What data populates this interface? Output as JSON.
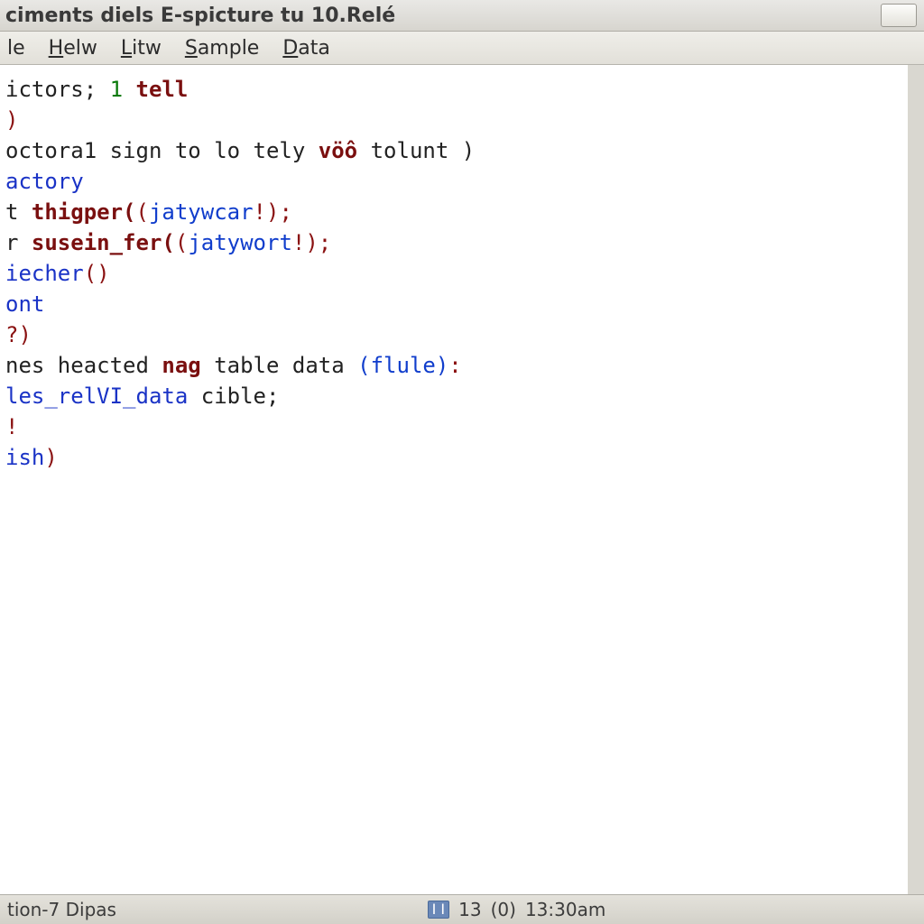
{
  "title": "ciments diels E-spicture tu 10.Relé",
  "menu": {
    "file": "le",
    "helw": "Helw",
    "litw": "Litw",
    "sample": "Sample",
    "data": "Data"
  },
  "code": {
    "l1a": "ictors; ",
    "l1b": "1 ",
    "l1c": "tell",
    "l2": ")",
    "l3a": "octora1 sign to lo tely ",
    "l3b": "vöô",
    "l3c": " tolunt )",
    "l4": "",
    "l5": "actory",
    "l6a": "t ",
    "l6b": "thigper(",
    "l6c": "(",
    "l6d": "jatywcar",
    "l6e": "!);",
    "l7a": "r ",
    "l7b": "susein_fer(",
    "l7c": "(",
    "l7d": "jatywort",
    "l7e": "!);",
    "l8a": "iecher",
    "l8b": "()",
    "l9": "ont",
    "l10": "?)",
    "l11a": "nes heacted ",
    "l11b": "nag",
    "l11c": " table data ",
    "l11d": "(flule)",
    "l11e": ":",
    "l12": "",
    "l13a": "les_relVI_data ",
    "l13b": "cible;",
    "l14": "!",
    "l15a": "ish",
    "l15b": ")"
  },
  "status": {
    "left": "tion-7 Dipas",
    "badge": "I I",
    "line": "13",
    "col": "(0)",
    "time": "13:30am"
  }
}
